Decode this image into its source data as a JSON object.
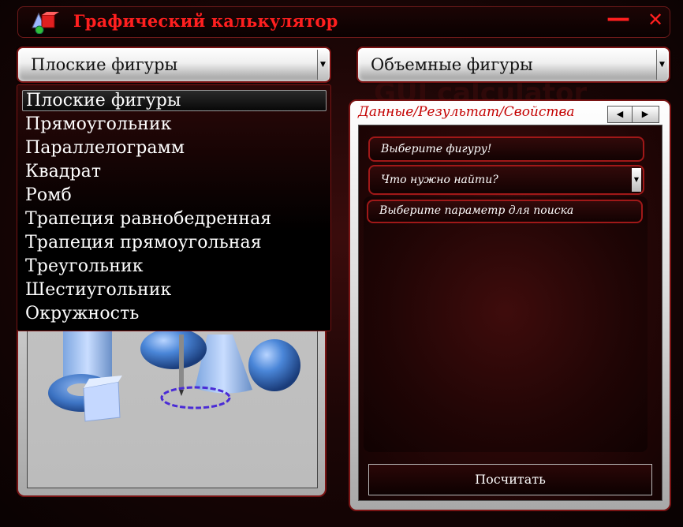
{
  "title_bar": {
    "title": "Графический калькулятор",
    "minimize_label": "—",
    "close_label": "✕",
    "icon": "shapes-icon"
  },
  "left_combo": {
    "value": "Плоские фигуры",
    "options": [
      "Плоские фигуры",
      "Прямоугольник",
      "Параллелограмм",
      "Квадрат",
      "Ромб",
      "Трапеция равнобедренная",
      "Трапеция прямоугольная",
      "Треугольник",
      "Шестиугольник",
      "Окружность"
    ]
  },
  "right_combo": {
    "value": "Объемные фигуры"
  },
  "watermark": "GUI calculator",
  "right_panel": {
    "tab_label": "Данные/Результат/Свойства",
    "figure_field": "Выберите фигуру!",
    "find_select": "Что нужно найти?",
    "param_field": "Выберите параметр для поиска",
    "calc_button": "Посчитать"
  },
  "colors": {
    "accent": "#ff1f1f",
    "border": "#7a1414",
    "panel_dark": "#2a0707"
  }
}
